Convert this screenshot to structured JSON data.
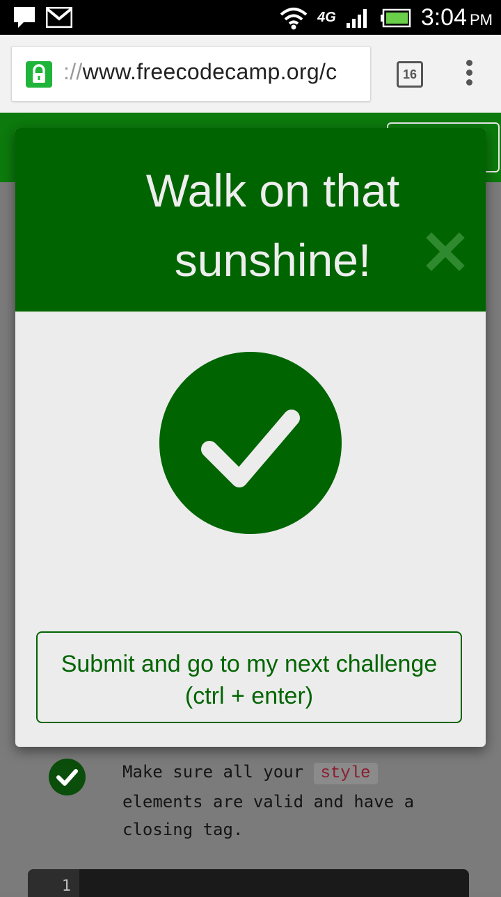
{
  "status_bar": {
    "time": "3:04",
    "ampm": "PM",
    "network": "4G",
    "icons": [
      "chat-icon",
      "gmail-icon",
      "wifi-icon",
      "signal-icon",
      "battery-icon"
    ]
  },
  "browser": {
    "url_scheme": "://",
    "url_host": "www.freecodecamp.org/c",
    "tab_count": "16"
  },
  "modal": {
    "title_line1": "Walk on that",
    "title_line2": "sunshine!",
    "submit_label": "Submit and go to my next challenge (ctrl + enter)"
  },
  "page": {
    "test_text_before": "Make sure all your ",
    "test_code": "style",
    "test_text_after": " elements are valid and have a closing tag.",
    "editor_line": "1"
  },
  "colors": {
    "brand_green": "#006400",
    "lock_green": "#1fb53a"
  }
}
